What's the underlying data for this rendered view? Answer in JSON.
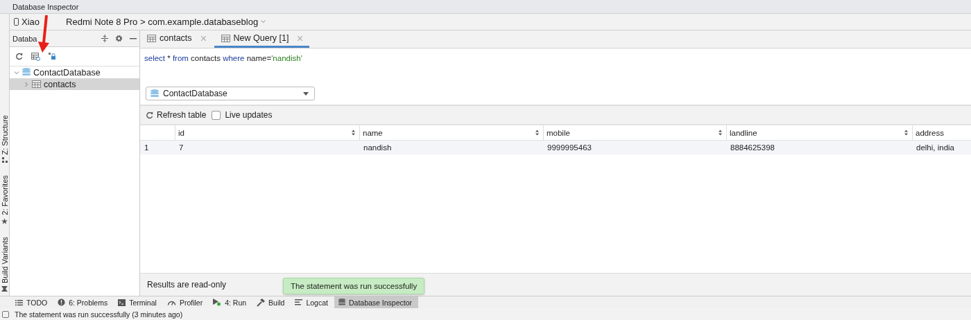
{
  "window": {
    "title": "Database Inspector"
  },
  "device_bar": {
    "device_visible": "Xiao",
    "device_rest": "Redmi Note 8 Pro > com.example.databaseblog"
  },
  "side_stripe": [
    {
      "label": "Z: Structure",
      "kind": "structure"
    },
    {
      "label": "2: Favorites",
      "kind": "favorites"
    },
    {
      "label": "Build Variants",
      "kind": "variants"
    }
  ],
  "sidebar": {
    "title": "Databa",
    "tree": [
      {
        "label": "ContactDatabase",
        "kind": "database",
        "expanded": true,
        "selected": false,
        "children": [
          {
            "label": "contacts",
            "kind": "table",
            "expanded": false,
            "selected": true
          }
        ]
      }
    ]
  },
  "tabs": [
    {
      "label": "contacts",
      "selected": false
    },
    {
      "label": "New Query [1]",
      "selected": true
    }
  ],
  "query": [
    {
      "text": "select",
      "kind": "keyword"
    },
    {
      "text": " * ",
      "kind": "plain"
    },
    {
      "text": "from",
      "kind": "keyword"
    },
    {
      "text": " contacts ",
      "kind": "plain"
    },
    {
      "text": "where",
      "kind": "keyword"
    },
    {
      "text": " name=",
      "kind": "plain"
    },
    {
      "text": "'nandish'",
      "kind": "string"
    }
  ],
  "database_select": {
    "value": "ContactDatabase"
  },
  "table_toolbar": {
    "refresh": "Refresh table",
    "live_updates": {
      "label": "Live updates",
      "checked": false
    }
  },
  "table": {
    "columns": [
      "id",
      "name",
      "mobile",
      "landline",
      "address"
    ],
    "rows": [
      {
        "number": "1",
        "cells": [
          "7",
          "nandish",
          "9999995463",
          "8884625398",
          "delhi, india"
        ]
      }
    ]
  },
  "results_note": "Results are read-only",
  "toast": "The statement was run successfully",
  "tool_windows": [
    {
      "label": "TODO",
      "kind": "todo",
      "selected": false
    },
    {
      "label": "6: Problems",
      "kind": "problems",
      "selected": false
    },
    {
      "label": "Terminal",
      "kind": "terminal",
      "selected": false
    },
    {
      "label": "Profiler",
      "kind": "profiler",
      "selected": false
    },
    {
      "label": "4: Run",
      "kind": "run",
      "selected": false
    },
    {
      "label": "Build",
      "kind": "build",
      "selected": false
    },
    {
      "label": "Logcat",
      "kind": "logcat",
      "selected": false
    },
    {
      "label": "Database Inspector",
      "kind": "database",
      "selected": true
    }
  ],
  "status_bar": "The statement was run successfully (3 minutes ago)"
}
